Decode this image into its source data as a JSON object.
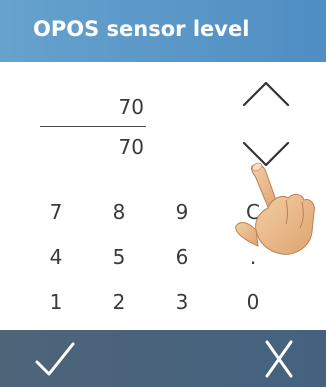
{
  "header": {
    "title": "OPOS sensor level"
  },
  "values": {
    "current": "70",
    "setpoint": "70"
  },
  "keypad": {
    "row1": [
      "7",
      "8",
      "9",
      "C"
    ],
    "row2": [
      "4",
      "5",
      "6",
      "."
    ],
    "row3": [
      "1",
      "2",
      "3",
      "0"
    ]
  },
  "icons": {
    "up": "chevron-up-icon",
    "down": "chevron-down-icon",
    "ok": "checkmark-icon",
    "cancel": "close-icon",
    "hand": "pointing-hand-icon"
  },
  "colors": {
    "header": "#5a9bcc",
    "footer": "#4a6380",
    "text": "#3a3a3a"
  }
}
